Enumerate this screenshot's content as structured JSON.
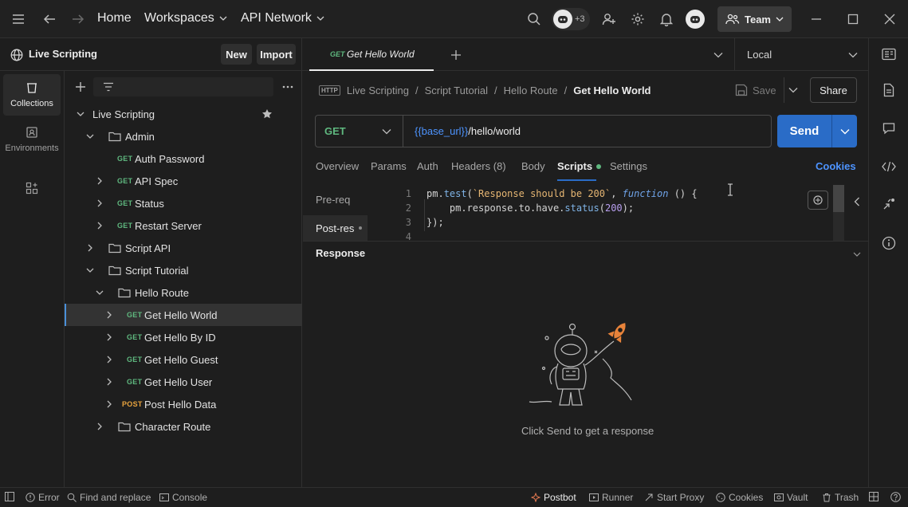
{
  "topbar": {
    "home": "Home",
    "workspaces": "Workspaces",
    "api_network": "API Network",
    "avatar_count": "+3",
    "team": "Team"
  },
  "sidebar": {
    "workspace_name": "Live Scripting",
    "new_label": "New",
    "import_label": "Import",
    "rail": [
      {
        "label": "Collections"
      },
      {
        "label": "Environments"
      }
    ],
    "tree": [
      {
        "label": "Live Scripting"
      },
      {
        "label": "Admin"
      },
      {
        "method": "GET",
        "label": "Auth Password"
      },
      {
        "method": "GET",
        "label": "API Spec"
      },
      {
        "method": "GET",
        "label": "Status"
      },
      {
        "method": "GET",
        "label": "Restart Server"
      },
      {
        "label": "Script API"
      },
      {
        "label": "Script Tutorial"
      },
      {
        "label": "Hello Route"
      },
      {
        "method": "GET",
        "label": "Get Hello World"
      },
      {
        "method": "GET",
        "label": "Get Hello By ID"
      },
      {
        "method": "GET",
        "label": "Get Hello Guest"
      },
      {
        "method": "GET",
        "label": "Get Hello User"
      },
      {
        "method": "POST",
        "label": "Post Hello Data"
      },
      {
        "label": "Character Route"
      }
    ]
  },
  "tab": {
    "method": "GET",
    "title": "Get Hello World"
  },
  "environment": "Local",
  "breadcrumb": {
    "items": [
      "Live Scripting",
      "Script Tutorial",
      "Hello Route"
    ],
    "current": "Get Hello World"
  },
  "request": {
    "save": "Save",
    "share": "Share",
    "method": "GET",
    "url_var": "{{base_url}}",
    "url_path": "/hello/world",
    "send": "Send",
    "tabs": [
      "Overview",
      "Params",
      "Auth",
      "Headers (8)",
      "Body",
      "Scripts",
      "Settings"
    ],
    "cookies": "Cookies",
    "script_tabs": [
      "Pre-req",
      "Post-res"
    ]
  },
  "editor": {
    "line_numbers": [
      "1",
      "2",
      "3",
      "4"
    ],
    "l1_a": "pm.",
    "l1_b": "test",
    "l1_c": "(",
    "l1_d": "`Response should be 200`",
    "l1_e": ", ",
    "l1_f": "function",
    "l1_g": " () {",
    "l2_a": "    pm.response.to.have.",
    "l2_b": "status",
    "l2_c": "(",
    "l2_d": "200",
    "l2_e": ");",
    "l3": "});"
  },
  "response": {
    "title": "Response",
    "empty": "Click Send to get a response"
  },
  "statusbar": {
    "error": "Error",
    "find": "Find and replace",
    "console": "Console",
    "postbot": "Postbot",
    "runner": "Runner",
    "proxy": "Start Proxy",
    "cookies": "Cookies",
    "vault": "Vault",
    "trash": "Trash"
  },
  "colors": {
    "accent": "#2a6cc7",
    "get": "#5fb87f",
    "post": "#e8a33d",
    "link": "#4d94ff"
  }
}
